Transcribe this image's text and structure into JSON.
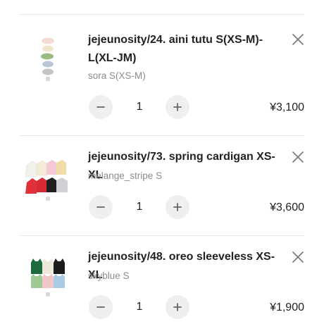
{
  "cart": {
    "items": [
      {
        "title": "jejeunosity/24. aini tutu S(XS-M)-L(XL-JM)",
        "variant": "sora S(XS-M)",
        "quantity": "1",
        "price": "¥3,100",
        "thumbnail_icon": "stacked-tutu-skirts"
      },
      {
        "title": "jejeunosity/73. spring cardigan XS-XL",
        "variant": "melange_stripe S",
        "quantity": "1",
        "price": "¥3,600",
        "thumbnail_icon": "cardigan-color-grid"
      },
      {
        "title": "jejeunosity/48. oreo sleeveless XS-XL",
        "variant": "skyblue S",
        "quantity": "1",
        "price": "¥1,900",
        "thumbnail_icon": "sleeveless-tops-grid"
      }
    ]
  },
  "icons": {
    "remove": "close-icon",
    "decrease": "minus-icon",
    "increase": "plus-icon"
  },
  "colors": {
    "text": "#222222",
    "muted": "#8c8c8c",
    "button_bg": "#efefef",
    "icon": "#666666"
  }
}
